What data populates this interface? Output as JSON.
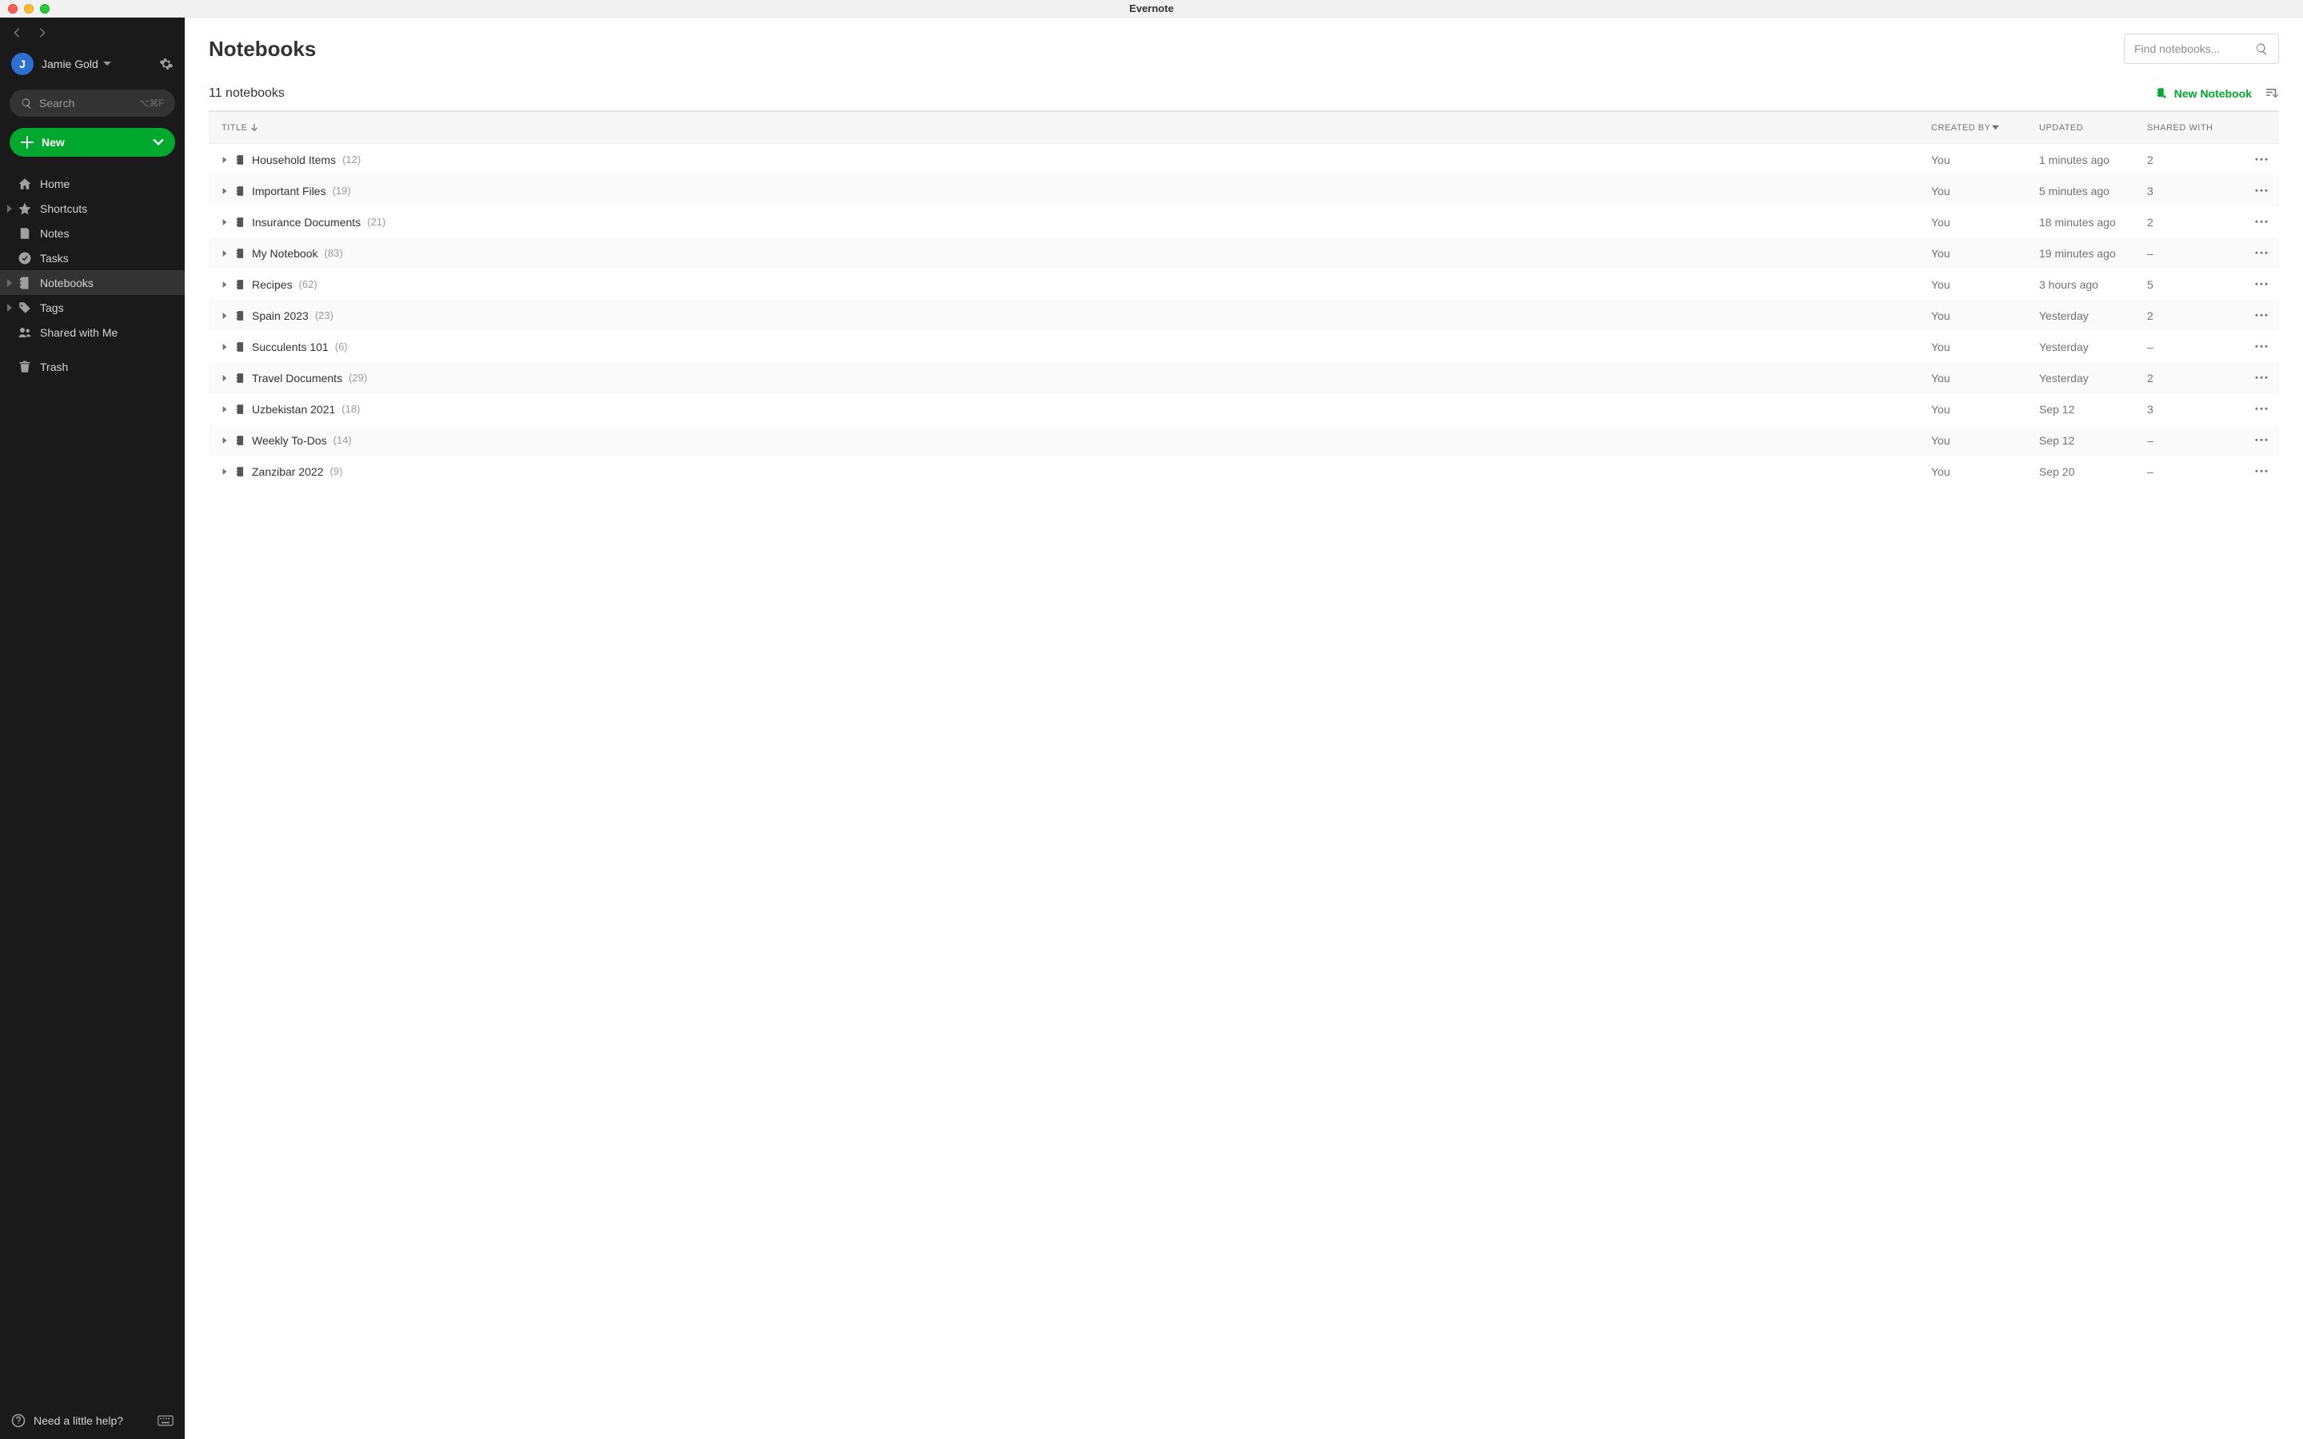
{
  "app": {
    "title": "Evernote"
  },
  "user": {
    "initial": "J",
    "name": "Jamie Gold"
  },
  "sidebar": {
    "search_placeholder": "Search",
    "search_shortcut": "⌥⌘F",
    "new_label": "New",
    "items": {
      "home": "Home",
      "shortcuts": "Shortcuts",
      "notes": "Notes",
      "tasks": "Tasks",
      "notebooks": "Notebooks",
      "tags": "Tags",
      "shared": "Shared with Me",
      "trash": "Trash"
    },
    "help_label": "Need a little help?"
  },
  "main": {
    "title": "Notebooks",
    "find_placeholder": "Find notebooks...",
    "count_text": "11 notebooks",
    "new_notebook_label": "New Notebook",
    "columns": {
      "title": "TITLE",
      "created_by": "CREATED BY",
      "updated": "UPDATED",
      "shared_with": "SHARED WITH"
    },
    "rows": [
      {
        "name": "Household Items",
        "count": "(12)",
        "created": "You",
        "updated": "1 minutes ago",
        "shared": "2"
      },
      {
        "name": "Important Files",
        "count": "(19)",
        "created": "You",
        "updated": "5 minutes ago",
        "shared": "3"
      },
      {
        "name": "Insurance Documents",
        "count": "(21)",
        "created": "You",
        "updated": "18 minutes ago",
        "shared": "2"
      },
      {
        "name": "My Notebook",
        "count": "(83)",
        "created": "You",
        "updated": "19 minutes ago",
        "shared": "–"
      },
      {
        "name": "Recipes",
        "count": "(62)",
        "created": "You",
        "updated": "3 hours ago",
        "shared": "5"
      },
      {
        "name": "Spain 2023",
        "count": "(23)",
        "created": "You",
        "updated": "Yesterday",
        "shared": "2"
      },
      {
        "name": "Succulents 101",
        "count": "(6)",
        "created": "You",
        "updated": "Yesterday",
        "shared": "–"
      },
      {
        "name": "Travel Documents",
        "count": "(29)",
        "created": "You",
        "updated": "Yesterday",
        "shared": "2"
      },
      {
        "name": "Uzbekistan 2021",
        "count": "(18)",
        "created": "You",
        "updated": "Sep 12",
        "shared": "3"
      },
      {
        "name": "Weekly To-Dos",
        "count": "(14)",
        "created": "You",
        "updated": "Sep 12",
        "shared": "–"
      },
      {
        "name": "Zanzibar 2022",
        "count": "(9)",
        "created": "You",
        "updated": "Sep 20",
        "shared": "–"
      }
    ]
  }
}
